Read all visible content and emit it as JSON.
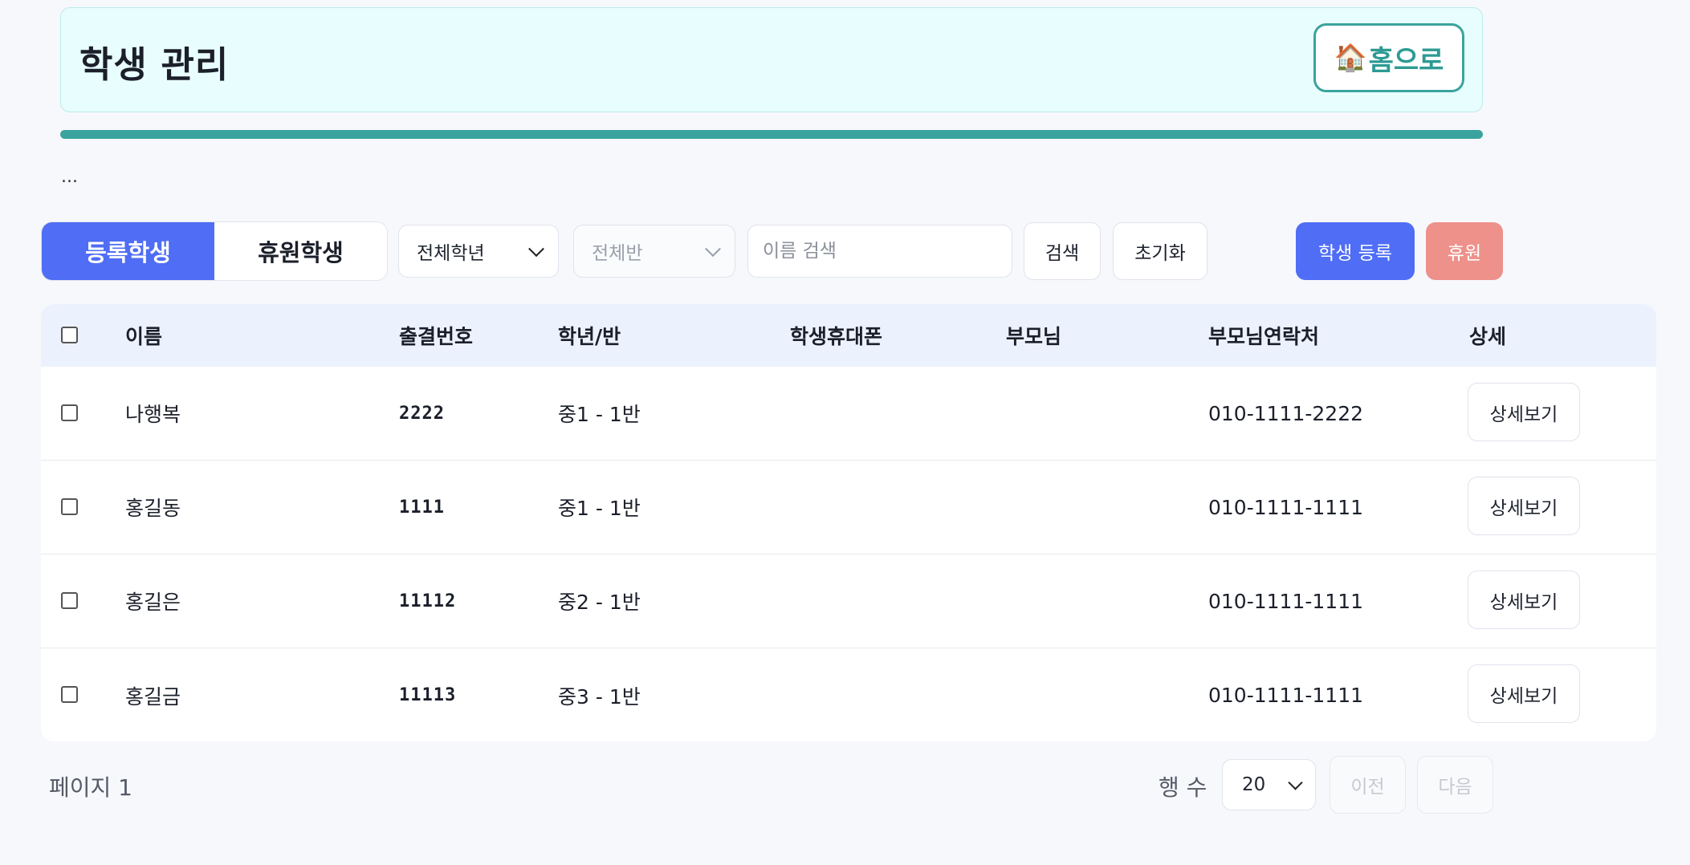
{
  "header": {
    "title": "학생 관리",
    "home_icon": "🏠",
    "home_label": "홈으로"
  },
  "status_text": "...",
  "tabs": [
    {
      "label": "등록학생",
      "active": true
    },
    {
      "label": "휴원학생",
      "active": false
    }
  ],
  "filters": {
    "grade_select": "전체학년",
    "class_select": "전체반",
    "search_placeholder": "이름 검색",
    "search_button": "검색",
    "reset_button": "초기화"
  },
  "actions": {
    "register_button": "학생 등록",
    "leave_button": "휴원"
  },
  "table": {
    "columns": [
      "이름",
      "출결번호",
      "학년/반",
      "학생휴대폰",
      "부모님",
      "부모님연락처",
      "상세"
    ],
    "rows": [
      {
        "name": "나행복",
        "attendance_no": "2222",
        "grade_class": "중1 - 1반",
        "student_phone": "",
        "parent": "",
        "parent_phone": "010-1111-2222",
        "detail": "상세보기"
      },
      {
        "name": "홍길동",
        "attendance_no": "1111",
        "grade_class": "중1 - 1반",
        "student_phone": "",
        "parent": "",
        "parent_phone": "010-1111-1111",
        "detail": "상세보기"
      },
      {
        "name": "홍길은",
        "attendance_no": "11112",
        "grade_class": "중2 - 1반",
        "student_phone": "",
        "parent": "",
        "parent_phone": "010-1111-1111",
        "detail": "상세보기"
      },
      {
        "name": "홍길금",
        "attendance_no": "11113",
        "grade_class": "중3 - 1반",
        "student_phone": "",
        "parent": "",
        "parent_phone": "010-1111-1111",
        "detail": "상세보기"
      }
    ]
  },
  "footer": {
    "page_label": "페이지 1",
    "rows_label": "행 수",
    "rows_value": "20",
    "prev_button": "이전",
    "next_button": "다음"
  },
  "colors": {
    "accent": "#4f6df5",
    "teal": "#3aa39e",
    "danger": "#ee918b"
  }
}
